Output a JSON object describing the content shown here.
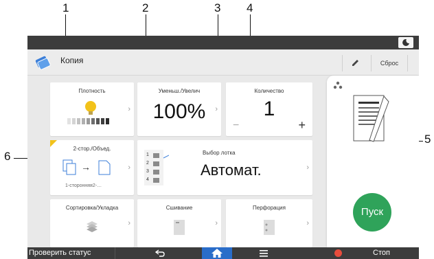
{
  "callouts": [
    "1",
    "2",
    "3",
    "4",
    "5",
    "6"
  ],
  "app": {
    "title": "Копия",
    "reset_label": "Сброс"
  },
  "tiles": {
    "density": {
      "label": "Плотность"
    },
    "reduce_enlarge": {
      "label": "Уменьш./Увелич",
      "value": "100%"
    },
    "quantity": {
      "label": "Количество",
      "value": "1",
      "minus": "−",
      "plus": "+"
    },
    "duplex": {
      "label": "2-стор./Объед.",
      "sub": "1-сторонняя2-…",
      "arrow": "→"
    },
    "tray": {
      "label": "Выбор лотка",
      "value": "Автомат.",
      "tray_numbers": [
        "1",
        "2",
        "3",
        "4"
      ]
    },
    "sort": {
      "label": "Сортировка/Укладка"
    },
    "staple": {
      "label": "Сшивание"
    },
    "punch": {
      "label": "Перфорация"
    }
  },
  "start_label": "Пуск",
  "bottom_bar": {
    "status_label": "Проверить статус",
    "stop_label": "Стоп"
  },
  "colors": {
    "start": "#2fa35a",
    "home": "#2a6dc9",
    "stop": "#e74c3c",
    "bar": "#3c3c3c",
    "density_bulb": "#f2c21a"
  },
  "icons": [
    "moon-icon",
    "copy-app-icon",
    "edit-icon",
    "back-icon",
    "home-icon",
    "menu-icon",
    "stop-icon",
    "toner-icon",
    "document-preview-icon",
    "density-bulb-icon",
    "tray-icon",
    "sort-icon",
    "staple-icon",
    "punch-icon"
  ]
}
